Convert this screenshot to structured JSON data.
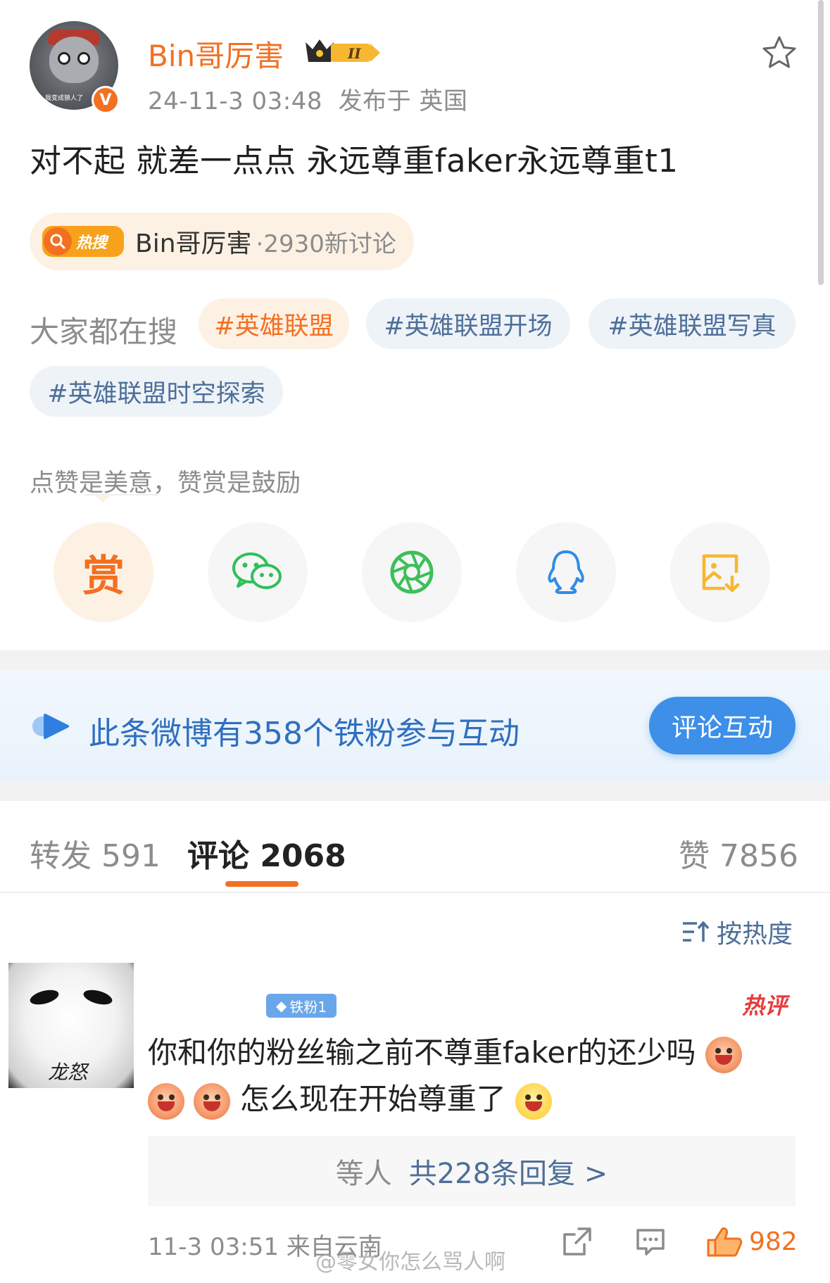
{
  "post": {
    "username": "Bin哥厉害",
    "level_badge": "II",
    "date": "24-11-3 03:48",
    "location": "发布于 英国",
    "text": "对不起 就差一点点 永远尊重faker永远尊重t1",
    "avatar_caption": "我变成狼人了"
  },
  "hot_search": {
    "icon_label": "热搜",
    "topic": "Bin哥厉害",
    "discussions": "·2930新讨论"
  },
  "searching": {
    "label": "大家都在搜",
    "tags": [
      "#英雄联盟",
      "#英雄联盟开场",
      "#英雄联盟写真",
      "#英雄联盟时空探索"
    ]
  },
  "reward": {
    "hint": "点赞是美意，赞赏是鼓励",
    "reward_char": "赏"
  },
  "fans_banner": {
    "text": "此条微博有358个铁粉参与互动",
    "button": "评论互动"
  },
  "tabs": {
    "repost": "转发 591",
    "comments": "评论 2068",
    "likes": "赞 7856"
  },
  "sort_label": "按热度",
  "comment": {
    "fan_badge": "铁粉1",
    "hot_label": "热评",
    "avatar_caption": "龙怒",
    "line1": "你和你的粉丝输之前不尊重faker的还少吗",
    "line2": "怎么现在开始尊重了",
    "replies_who": "等人",
    "replies_count": "共228条回复 >",
    "time": "11-3 03:51",
    "location": "来自云南",
    "like_count": "982"
  },
  "watermark": "@零女你怎么骂人啊",
  "colors": {
    "accent": "#f37021",
    "link_blue": "#4e6f99",
    "banner_blue": "#2f6fbf",
    "button_blue": "#3d8fe8"
  },
  "icons": [
    "verified-v-icon",
    "crown-level-icon",
    "star-icon",
    "wechat-icon",
    "moments-icon",
    "qq-icon",
    "save-image-icon",
    "fans-play-icon",
    "sort-icon",
    "share-icon",
    "comment-icon",
    "like-icon"
  ]
}
